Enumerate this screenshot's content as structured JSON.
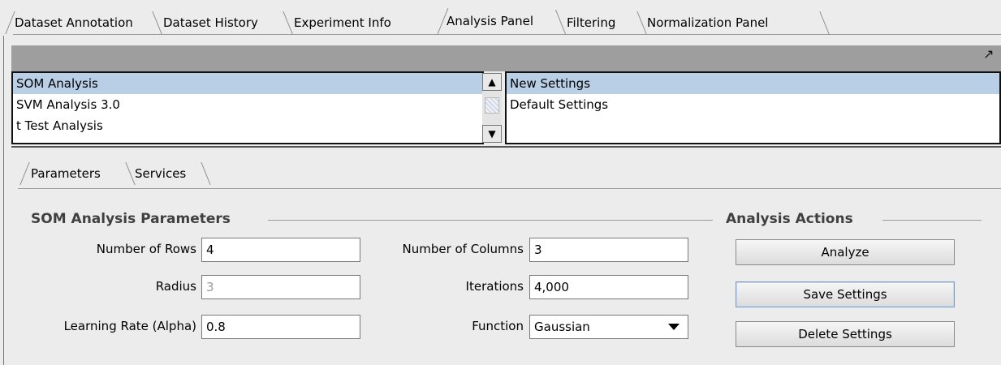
{
  "top_tabs": [
    {
      "label": "Dataset Annotation"
    },
    {
      "label": "Dataset History"
    },
    {
      "label": "Experiment Info"
    },
    {
      "label": "Analysis Panel"
    },
    {
      "label": "Filtering"
    },
    {
      "label": "Normalization Panel"
    }
  ],
  "selected_top_tab": "Analysis Panel",
  "analysis_list": [
    {
      "label": "SOM Analysis",
      "selected": true
    },
    {
      "label": "SVM Analysis 3.0",
      "selected": false
    },
    {
      "label": "t Test Analysis",
      "selected": false
    }
  ],
  "settings_list": [
    {
      "label": "New Settings",
      "selected": true
    },
    {
      "label": "Default Settings",
      "selected": false
    }
  ],
  "inner_tabs": [
    {
      "label": "Parameters"
    },
    {
      "label": "Services"
    }
  ],
  "params": {
    "group_title": "SOM Analysis Parameters",
    "rows_label": "Number of Rows",
    "rows_value": "4",
    "cols_label": "Number of Columns",
    "cols_value": "3",
    "radius_label": "Radius",
    "radius_value": "3",
    "iterations_label": "Iterations",
    "iterations_value": "4,000",
    "alpha_label": "Learning Rate (Alpha)",
    "alpha_value": "0.8",
    "function_label": "Function",
    "function_value": "Gaussian"
  },
  "actions": {
    "group_title": "Analysis Actions",
    "analyze": "Analyze",
    "save": "Save Settings",
    "delete": "Delete Settings"
  },
  "icons": {
    "maximize": "maximize-icon",
    "scroll_up": "arrow-up-icon",
    "scroll_down": "arrow-down-icon"
  },
  "colors": {
    "selection": "#b8cfe5",
    "header_bar": "#9e9e9e"
  }
}
